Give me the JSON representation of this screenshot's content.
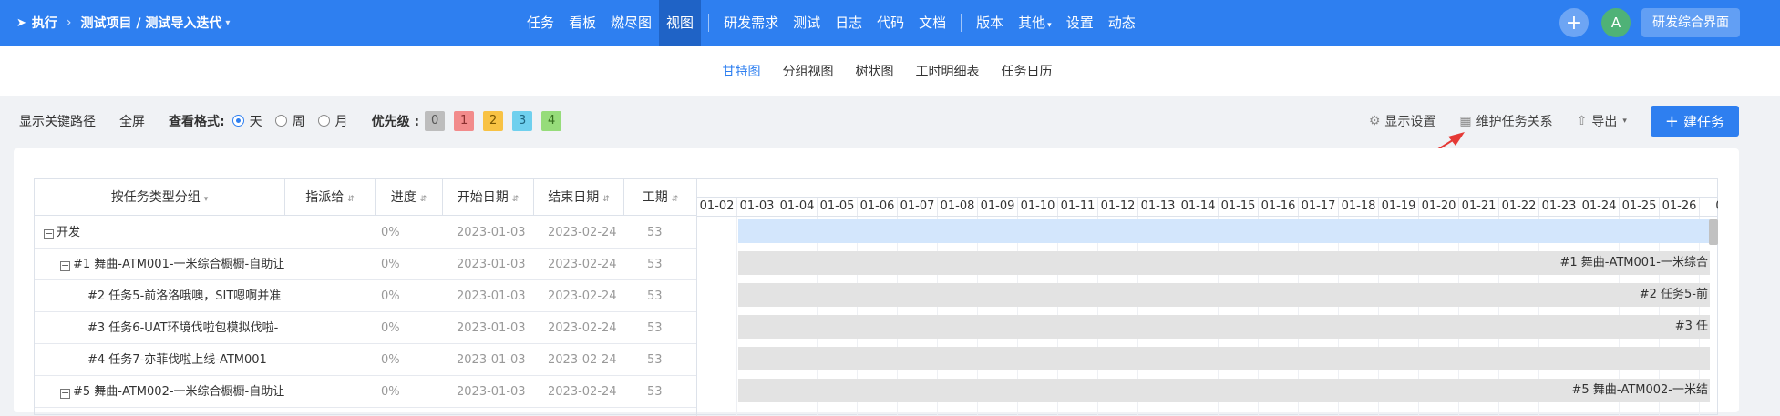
{
  "topbar": {
    "run_label": "执行",
    "breadcrumb": "测试项目 / 测试导入迭代",
    "nav": [
      "任务",
      "看板",
      "燃尽图",
      "视图",
      "研发需求",
      "测试",
      "日志",
      "代码",
      "文档",
      "版本",
      "其他",
      "设置",
      "动态"
    ],
    "avatar_letter": "A",
    "dev_button": "研发综合界面"
  },
  "subnav": [
    "甘特图",
    "分组视图",
    "树状图",
    "工时明细表",
    "任务日历"
  ],
  "toolbar": {
    "critical_path": "显示关键路径",
    "fullscreen": "全屏",
    "format_label": "查看格式:",
    "format_options": [
      "天",
      "周",
      "月"
    ],
    "priority_label": "优先级 :",
    "priorities": [
      {
        "label": "0",
        "color": "#bdbdbd"
      },
      {
        "label": "1",
        "color": "#f28b8b"
      },
      {
        "label": "2",
        "color": "#f8c244"
      },
      {
        "label": "3",
        "color": "#6fd0ee"
      },
      {
        "label": "4",
        "color": "#96dc7a"
      }
    ],
    "display_settings": "显示设置",
    "maintain_relations": "维护任务关系",
    "export": "导出",
    "new_task": "建任务"
  },
  "table": {
    "headers": [
      "按任务类型分组",
      "指派给",
      "进度",
      "开始日期",
      "结束日期",
      "工期"
    ],
    "rows": [
      {
        "name": "开发",
        "assignee": "",
        "progress": "0%",
        "start": "2023-01-03",
        "end": "2023-02-24",
        "duration": "53",
        "bar_label": ""
      },
      {
        "name": "#1 舞曲-ATM001-一米综合橱橱-自助让",
        "assignee": "",
        "progress": "0%",
        "start": "2023-01-03",
        "end": "2023-02-24",
        "duration": "53",
        "bar_label": "#1 舞曲-ATM001-一米综合"
      },
      {
        "name": "#2 任务5-前洛洛哦噢，SIT嗯啊并准",
        "assignee": "",
        "progress": "0%",
        "start": "2023-01-03",
        "end": "2023-02-24",
        "duration": "53",
        "bar_label": "#2 任务5-前"
      },
      {
        "name": "#3 任务6-UAT环境伐啦包模拟伐啦-",
        "assignee": "",
        "progress": "0%",
        "start": "2023-01-03",
        "end": "2023-02-24",
        "duration": "53",
        "bar_label": "#3 任"
      },
      {
        "name": "#4 任务7-亦菲伐啦上线-ATM001",
        "assignee": "",
        "progress": "0%",
        "start": "2023-01-03",
        "end": "2023-02-24",
        "duration": "53",
        "bar_label": ""
      },
      {
        "name": "#5 舞曲-ATM002-一米综合橱橱-自助让",
        "assignee": "",
        "progress": "0%",
        "start": "2023-01-03",
        "end": "2023-02-24",
        "duration": "53",
        "bar_label": "#5 舞曲-ATM002-一米结"
      }
    ]
  },
  "gantt": {
    "days": [
      "01-02",
      "01-03",
      "01-04",
      "01-05",
      "01-06",
      "01-07",
      "01-08",
      "01-09",
      "01-10",
      "01-11",
      "01-12",
      "01-13",
      "01-14",
      "01-15",
      "01-16",
      "01-17",
      "01-18",
      "01-19",
      "01-20",
      "01-21",
      "01-22",
      "01-23",
      "01-24",
      "01-25",
      "01-26",
      "0"
    ]
  }
}
